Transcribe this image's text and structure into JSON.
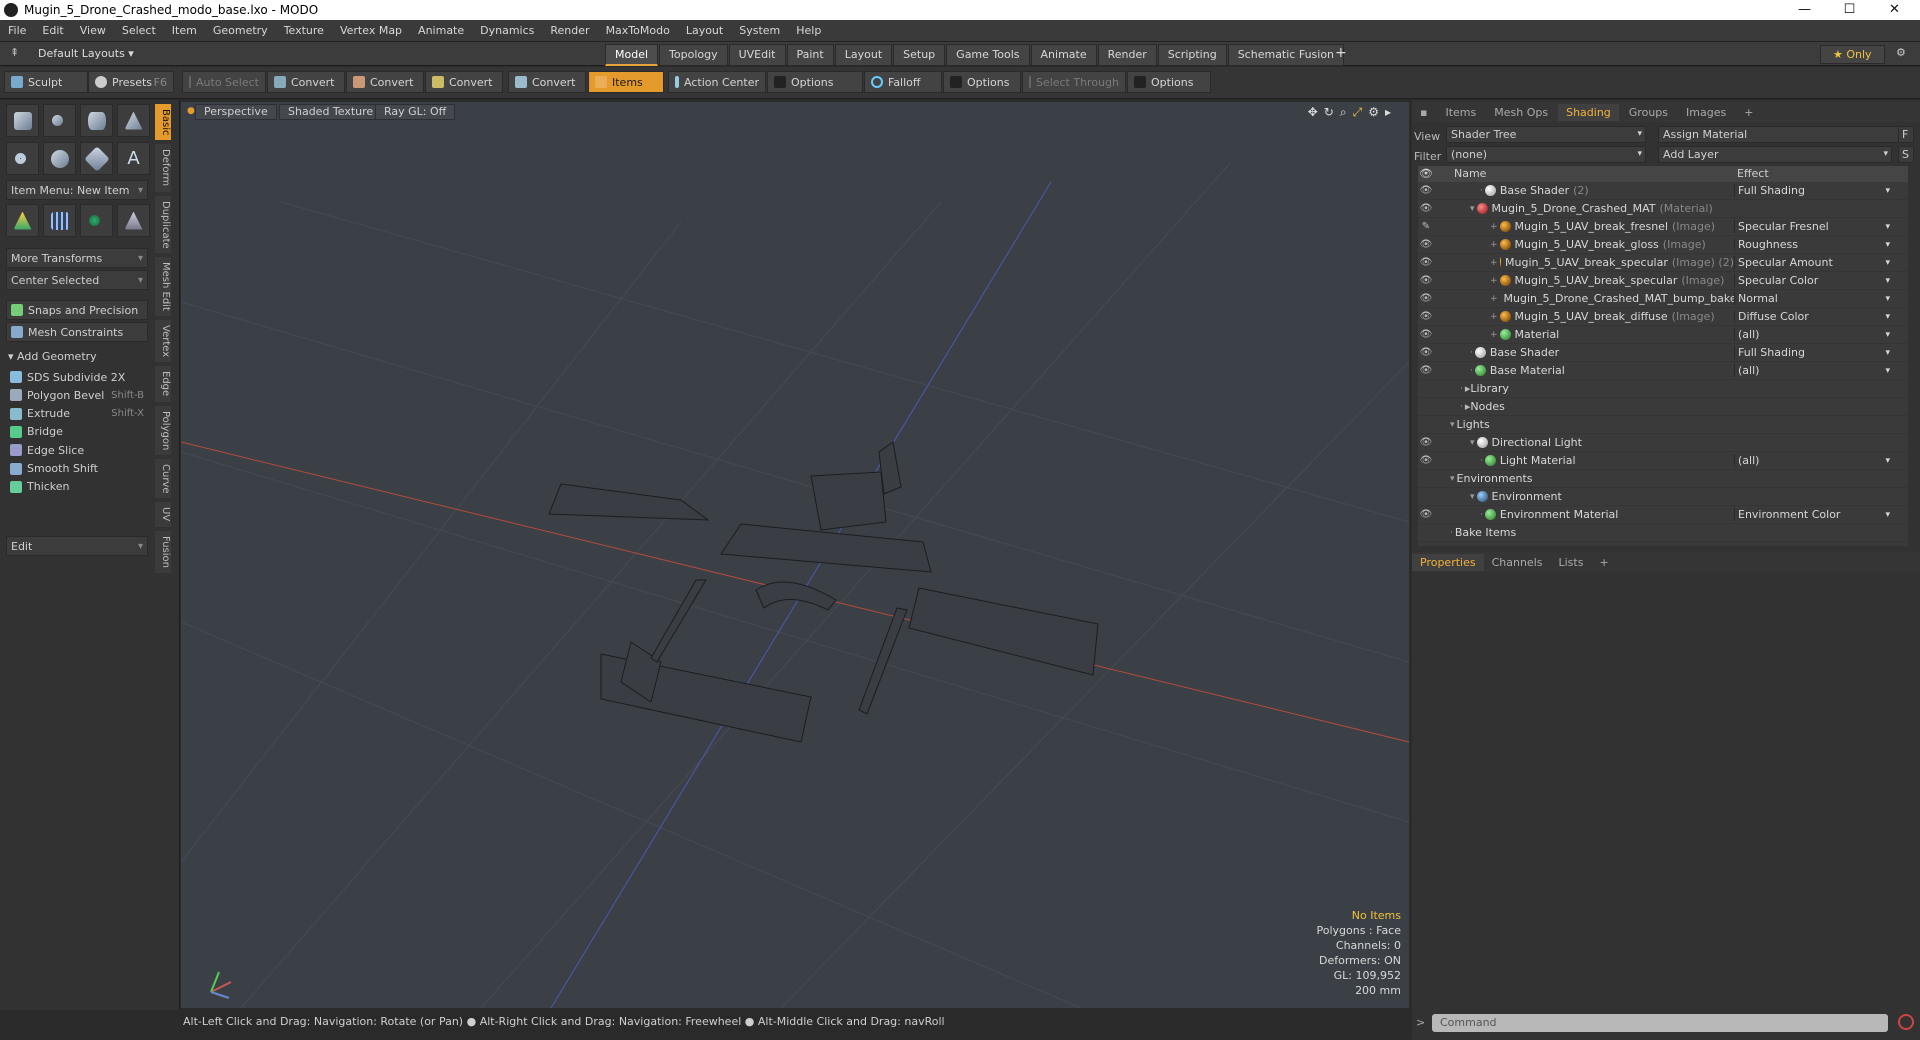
{
  "window": {
    "title": "Mugin_5_Drone_Crashed_modo_base.lxo - MODO",
    "minimize": "—",
    "maximize": "☐",
    "close": "✕"
  },
  "menu": [
    "File",
    "Edit",
    "View",
    "Select",
    "Item",
    "Geometry",
    "Texture",
    "Vertex Map",
    "Animate",
    "Dynamics",
    "Render",
    "MaxToModo",
    "Layout",
    "System",
    "Help"
  ],
  "layout": {
    "default_layouts": "Default Layouts ▾",
    "only": "★  Only",
    "add": "+"
  },
  "layout_tabs": [
    "Model",
    "Topology",
    "UVEdit",
    "Paint",
    "Layout",
    "Setup",
    "Game Tools",
    "Animate",
    "Render",
    "Scripting",
    "Schematic Fusion"
  ],
  "toolbar": {
    "sculpt": "Sculpt",
    "presets": "Presets",
    "presets_key": "F6",
    "auto_select": "Auto Select",
    "convert": "Convert",
    "items": "Items",
    "action_center": "Action Center",
    "options": "Options",
    "falloff": "Falloff",
    "select_through": "Select Through"
  },
  "left_panel": {
    "vertical_tabs": [
      "Basic",
      "Deform",
      "Duplicate",
      "Mesh Edit",
      "Vertex",
      "Edge",
      "Polygon",
      "Curve",
      "UV",
      "Fusion"
    ],
    "item_menu": "Item Menu: New Item",
    "more_transforms": "More Transforms",
    "center_selected": "Center Selected",
    "snaps": "Snaps and Precision",
    "mesh_constraints": "Mesh Constraints",
    "add_geometry": "Add Geometry",
    "tools": [
      {
        "label": "SDS Subdivide 2X",
        "key": ""
      },
      {
        "label": "Polygon Bevel",
        "key": "Shift-B"
      },
      {
        "label": "Extrude",
        "key": "Shift-X"
      },
      {
        "label": "Bridge",
        "key": ""
      },
      {
        "label": "Edge Slice",
        "key": ""
      },
      {
        "label": "Smooth Shift",
        "key": ""
      },
      {
        "label": "Thicken",
        "key": ""
      }
    ],
    "edit": "Edit"
  },
  "viewport": {
    "view": "Perspective",
    "shading": "Shaded Texture",
    "raygl": "Ray GL: Off",
    "stats": {
      "no_items": "No Items",
      "polygons": "Polygons : Face",
      "channels": "Channels: 0",
      "deformers": "Deformers: ON",
      "gl": "GL: 109,952",
      "size": "200 mm"
    }
  },
  "status": "Alt-Left Click and Drag: Navigation: Rotate (or Pan) ● Alt-Right Click and Drag: Navigation: Freewheel ● Alt-Middle Click and Drag: navRoll",
  "right_panel": {
    "tabs": [
      "Items",
      "Mesh Ops",
      "Shading",
      "Groups",
      "Images",
      "+"
    ],
    "view_label": "View",
    "view_value": "Shader Tree",
    "assign_material": "Assign Material",
    "f_btn": "F",
    "filter_label": "Filter",
    "filter_value": "(none)",
    "add_layer": "Add Layer",
    "s_btn": "S",
    "col_name": "Name",
    "col_effect": "Effect",
    "rows": [
      {
        "indent": 3,
        "name": "Base Shader",
        "tag": "(2)",
        "effect": "Full Shading",
        "ball": "b-white",
        "eye": "👁"
      },
      {
        "indent": 2,
        "name": "Mugin_5_Drone_Crashed_MAT",
        "tag": "(Material)",
        "effect": "",
        "ball": "b-red",
        "eye": "👁"
      },
      {
        "indent": 4,
        "name": "Mugin_5_UAV_break_fresnel",
        "tag": "(Image)",
        "effect": "Specular Fresnel",
        "ball": "b-orange",
        "eye": "✎"
      },
      {
        "indent": 4,
        "name": "Mugin_5_UAV_break_gloss",
        "tag": "(Image)",
        "effect": "Roughness",
        "ball": "b-orange",
        "eye": "👁"
      },
      {
        "indent": 4,
        "name": "Mugin_5_UAV_break_specular",
        "tag": "(Image) (2)",
        "effect": "Specular Amount",
        "ball": "b-orange",
        "eye": "👁"
      },
      {
        "indent": 4,
        "name": "Mugin_5_UAV_break_specular",
        "tag": "(Image)",
        "effect": "Specular Color",
        "ball": "b-orange",
        "eye": "👁"
      },
      {
        "indent": 4,
        "name": "Mugin_5_Drone_Crashed_MAT_bump_bake ...",
        "tag": "",
        "effect": "Normal",
        "ball": "b-orange",
        "eye": "👁"
      },
      {
        "indent": 4,
        "name": "Mugin_5_UAV_break_diffuse",
        "tag": "(Image)",
        "effect": "Diffuse Color",
        "ball": "b-orange",
        "eye": "👁"
      },
      {
        "indent": 4,
        "name": "Material",
        "tag": "",
        "effect": "(all)",
        "ball": "b-green",
        "eye": "👁"
      },
      {
        "indent": 2,
        "name": "Base Shader",
        "tag": "",
        "effect": "Full Shading",
        "ball": "b-white",
        "eye": "👁"
      },
      {
        "indent": 2,
        "name": "Base Material",
        "tag": "",
        "effect": "(all)",
        "ball": "b-green",
        "eye": "👁"
      },
      {
        "indent": 1,
        "name": "Library",
        "tag": "",
        "effect": "",
        "ball": "",
        "eye": ""
      },
      {
        "indent": 1,
        "name": "Nodes",
        "tag": "",
        "effect": "",
        "ball": "",
        "eye": ""
      },
      {
        "indent": 0,
        "name": "Lights",
        "tag": "",
        "effect": "",
        "ball": "",
        "eye": ""
      },
      {
        "indent": 2,
        "name": "Directional Light",
        "tag": "",
        "effect": "",
        "ball": "b-white",
        "eye": "👁"
      },
      {
        "indent": 3,
        "name": "Light Material",
        "tag": "",
        "effect": "(all)",
        "ball": "b-green",
        "eye": "👁"
      },
      {
        "indent": 0,
        "name": "Environments",
        "tag": "",
        "effect": "",
        "ball": "",
        "eye": ""
      },
      {
        "indent": 2,
        "name": "Environment",
        "tag": "",
        "effect": "",
        "ball": "b-blue",
        "eye": ""
      },
      {
        "indent": 3,
        "name": "Environment Material",
        "tag": "",
        "effect": "Environment Color",
        "ball": "b-green",
        "eye": "👁"
      },
      {
        "indent": 0,
        "name": "Bake Items",
        "tag": "",
        "effect": "",
        "ball": "",
        "eye": ""
      }
    ],
    "props_tabs": [
      "Properties",
      "Channels",
      "Lists",
      "+"
    ],
    "command_placeholder": "Command"
  }
}
